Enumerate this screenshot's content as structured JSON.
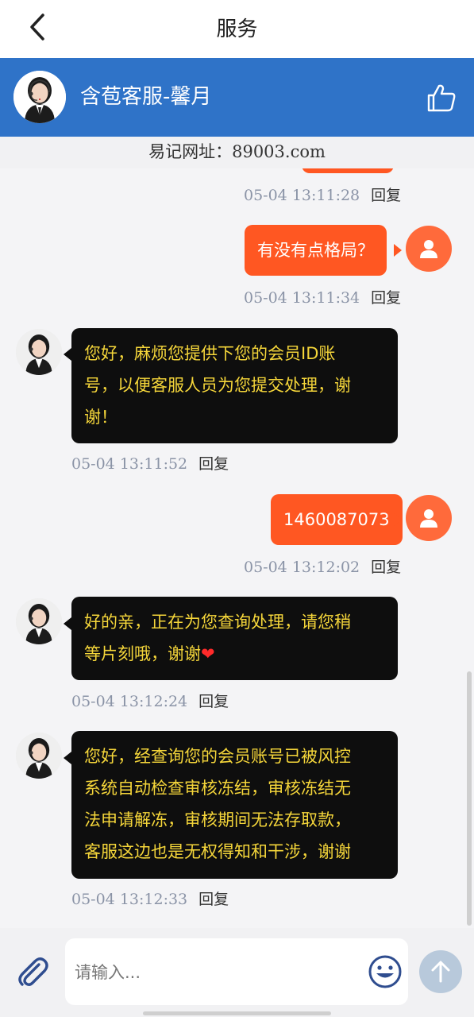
{
  "nav": {
    "title": "服务"
  },
  "agent": {
    "name": "含苞客服-馨月"
  },
  "notice": {
    "text": "易记网址：89003.com"
  },
  "messages": [
    {
      "time": "05-04 13:11:28",
      "reply": "回复"
    },
    {
      "direction": "out",
      "text": "有没有点格局？",
      "time": "05-04 13:11:34",
      "reply": "回复"
    },
    {
      "direction": "in",
      "lines": [
        "您好，麻烦您提供下您的会员ID账",
        "号，以便客服人员为您提交处理，谢",
        "谢！"
      ],
      "time": "05-04 13:11:52",
      "reply": "回复"
    },
    {
      "direction": "out",
      "text": "1460087073",
      "time": "05-04 13:12:02",
      "reply": "回复"
    },
    {
      "direction": "in",
      "lines": [
        "好的亲，正在为您查询处理，请您稍",
        "等片刻哦，谢谢"
      ],
      "emoji": "❤",
      "time": "05-04 13:12:24",
      "reply": "回复"
    },
    {
      "direction": "in",
      "lines": [
        "您好，经查询您的会员账号已被风控",
        "系统自动检查审核冻结，审核冻结无",
        "法申请解冻，审核期间无法存取款，",
        "客服这边也是无权得知和干涉，谢谢"
      ],
      "time": "05-04 13:12:33",
      "reply": "回复"
    }
  ],
  "input": {
    "placeholder": "请输入..."
  },
  "colors": {
    "brand": "#2f73c8",
    "outgoing": "#ff5722",
    "incoming_bg": "#0e0e0e",
    "incoming_text": "#f5d63a"
  },
  "icons": [
    "back-arrow-icon",
    "thumbs-up-icon",
    "paperclip-icon",
    "smile-icon",
    "arrow-up-icon",
    "user-icon"
  ]
}
